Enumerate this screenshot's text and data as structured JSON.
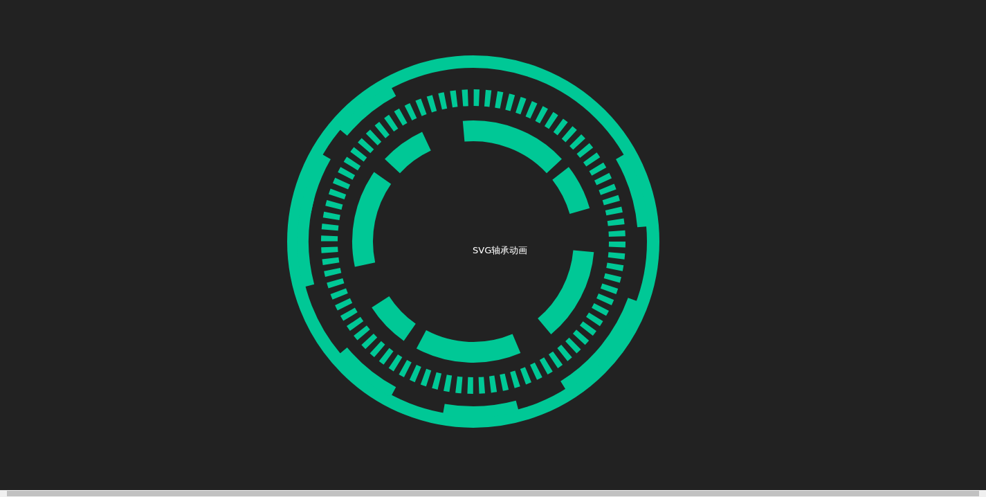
{
  "title": "SVG轴承动画"
}
